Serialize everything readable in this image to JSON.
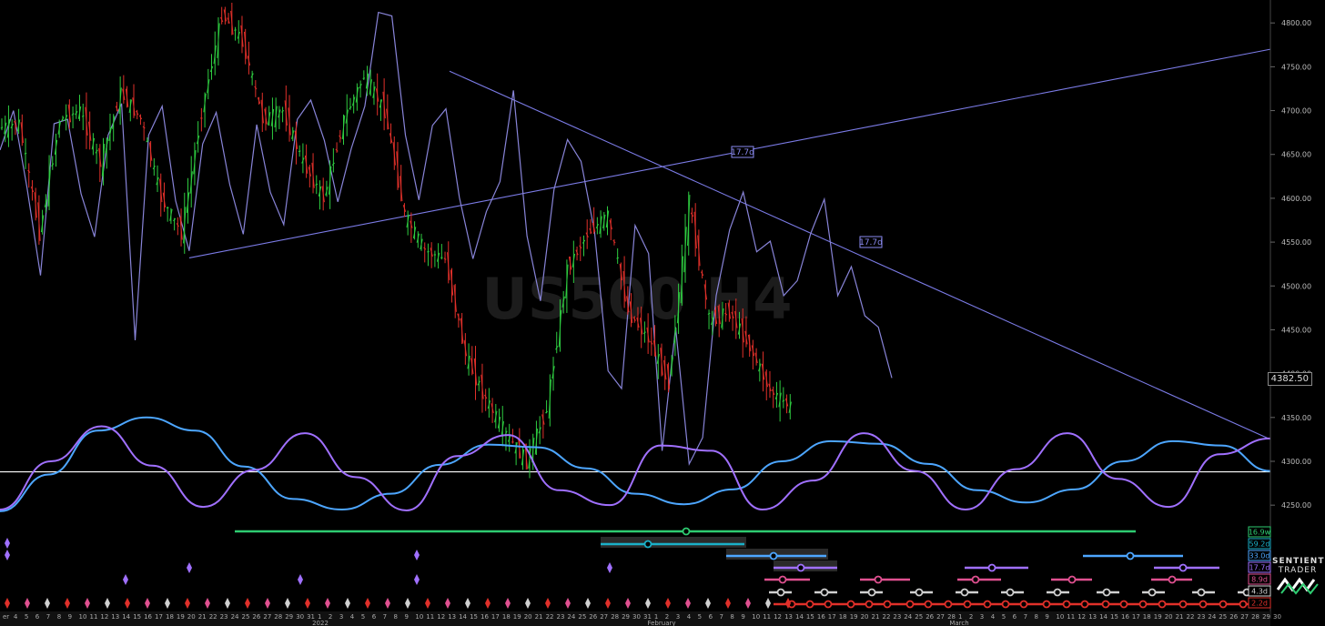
{
  "watermark": "US500 H4",
  "current_price": "4382.50",
  "colors": {
    "background": "#000000",
    "candle_up": "#2ecc40",
    "candle_down": "#e0302a",
    "composite_line": "#8884d8",
    "trendline": "#7b7be6",
    "cycle_a": "#4da6ff",
    "cycle_b": "#a070ff",
    "horizontal_line": "#ffffff"
  },
  "annotations": [
    {
      "label": "17.7d",
      "color": "#8a8af0"
    },
    {
      "label": "17.7d",
      "color": "#8a8af0"
    }
  ],
  "period_legend": [
    {
      "label": "16.9w",
      "color": "#2ecc71"
    },
    {
      "label": "59.2d",
      "color": "#1ab0c8"
    },
    {
      "label": "33.0d",
      "color": "#4da6ff"
    },
    {
      "label": "17.7d",
      "color": "#a070ff"
    },
    {
      "label": "8.9d",
      "color": "#e05090"
    },
    {
      "label": "4.3d",
      "color": "#d0d0d0"
    },
    {
      "label": "2.2d",
      "color": "#e0302a"
    }
  ],
  "logo": {
    "line1": "SENTIENT",
    "line2": "TRADER"
  },
  "chart_data": {
    "type": "line",
    "title": "US500 H4",
    "ylim": [
      4218,
      4822
    ],
    "y_ticks": [
      4250,
      4300,
      4350,
      4400,
      4450,
      4500,
      4550,
      4600,
      4650,
      4700,
      4750,
      4800
    ],
    "y_tick_labels": [
      "4250.00",
      "4300.00",
      "4350.00",
      "4400.00",
      "4450.00",
      "4500.00",
      "4550.00",
      "4600.00",
      "4650.00",
      "4700.00",
      "4750.00",
      "4800.00"
    ],
    "x_tick_labels": [
      "er",
      "4",
      "5",
      "6",
      "7",
      "8",
      "9",
      "10",
      "11",
      "12",
      "13",
      "14",
      "15",
      "16",
      "17",
      "18",
      "19",
      "20",
      "21",
      "22",
      "23",
      "24",
      "25",
      "26",
      "27",
      "28",
      "29",
      "30",
      "31",
      "1",
      "2",
      "3",
      "4",
      "5",
      "6",
      "7",
      "8",
      "9",
      "10",
      "11",
      "12",
      "13",
      "14",
      "15",
      "16",
      "17",
      "18",
      "19",
      "20",
      "21",
      "22",
      "23",
      "24",
      "25",
      "26",
      "27",
      "28",
      "29",
      "30",
      "31",
      "1",
      "2",
      "3",
      "4",
      "5",
      "6",
      "7",
      "8",
      "9",
      "10",
      "11",
      "12",
      "13",
      "14",
      "15",
      "16",
      "17",
      "18",
      "19",
      "20",
      "21",
      "22",
      "23",
      "24",
      "25",
      "26",
      "27",
      "28",
      "1",
      "2",
      "3",
      "4",
      "5",
      "6",
      "7",
      "8",
      "9",
      "10",
      "11",
      "12",
      "13",
      "14",
      "15",
      "16",
      "17",
      "18",
      "19",
      "20",
      "21",
      "22",
      "23",
      "24",
      "25",
      "26",
      "27",
      "28",
      "29",
      "30"
    ],
    "month_labels": [
      "2022",
      "February",
      "March"
    ],
    "horizontal_line": 4288,
    "trendlines": [
      {
        "from": [
          "Dec 20",
          4532
        ],
        "to": [
          "Mar 30",
          4770
        ]
      },
      {
        "from": [
          "Jan 4",
          4745
        ],
        "to": [
          "Mar 30",
          4325
        ]
      }
    ],
    "series": [
      {
        "name": "Composite model",
        "points": [
          4655,
          4700,
          4612,
          4512,
          4685,
          4690,
          4605,
          4556,
          4672,
          4708,
          4438,
          4672,
          4705,
          4597,
          4540,
          4662,
          4698,
          4616,
          4559,
          4684,
          4607,
          4570,
          4690,
          4712,
          4666,
          4596,
          4657,
          4705,
          4812,
          4808,
          4672,
          4598,
          4683,
          4702,
          4601,
          4531,
          4585,
          4619,
          4723,
          4557,
          4483,
          4610,
          4667,
          4642,
          4562,
          4403,
          4383,
          4569,
          4537,
          4312,
          4453,
          4297,
          4327,
          4489,
          4564,
          4607,
          4539,
          4551,
          4489,
          4506,
          4560,
          4599,
          4489,
          4522,
          4466,
          4453,
          4395
        ]
      },
      {
        "name": "OHLC close",
        "points": [
          4680,
          4685,
          4560,
          4690,
          4700,
          4640,
          4720,
          4690,
          4600,
          4560,
          4700,
          4810,
          4780,
          4690,
          4700,
          4640,
          4600,
          4690,
          4740,
          4700,
          4580,
          4540,
          4530,
          4420,
          4370,
          4330,
          4300,
          4360,
          4520,
          4560,
          4580,
          4470,
          4440,
          4390,
          4595,
          4460,
          4470,
          4430,
          4380,
          4362
        ]
      },
      {
        "name": "Cycle A",
        "points": [
          4243,
          4285,
          4335,
          4350,
          4335,
          4294,
          4257,
          4245,
          4263,
          4296,
          4319,
          4316,
          4292,
          4263,
          4251,
          4268,
          4300,
          4323,
          4320,
          4297,
          4267,
          4253,
          4268,
          4300,
          4323,
          4318,
          4289
        ]
      },
      {
        "name": "Cycle B",
        "points": [
          4245,
          4300,
          4340,
          4295,
          4248,
          4290,
          4332,
          4282,
          4244,
          4306,
          4330,
          4267,
          4250,
          4318,
          4312,
          4245,
          4278,
          4332,
          4289,
          4245,
          4291,
          4332,
          4280,
          4248,
          4308,
          4326
        ]
      }
    ]
  }
}
